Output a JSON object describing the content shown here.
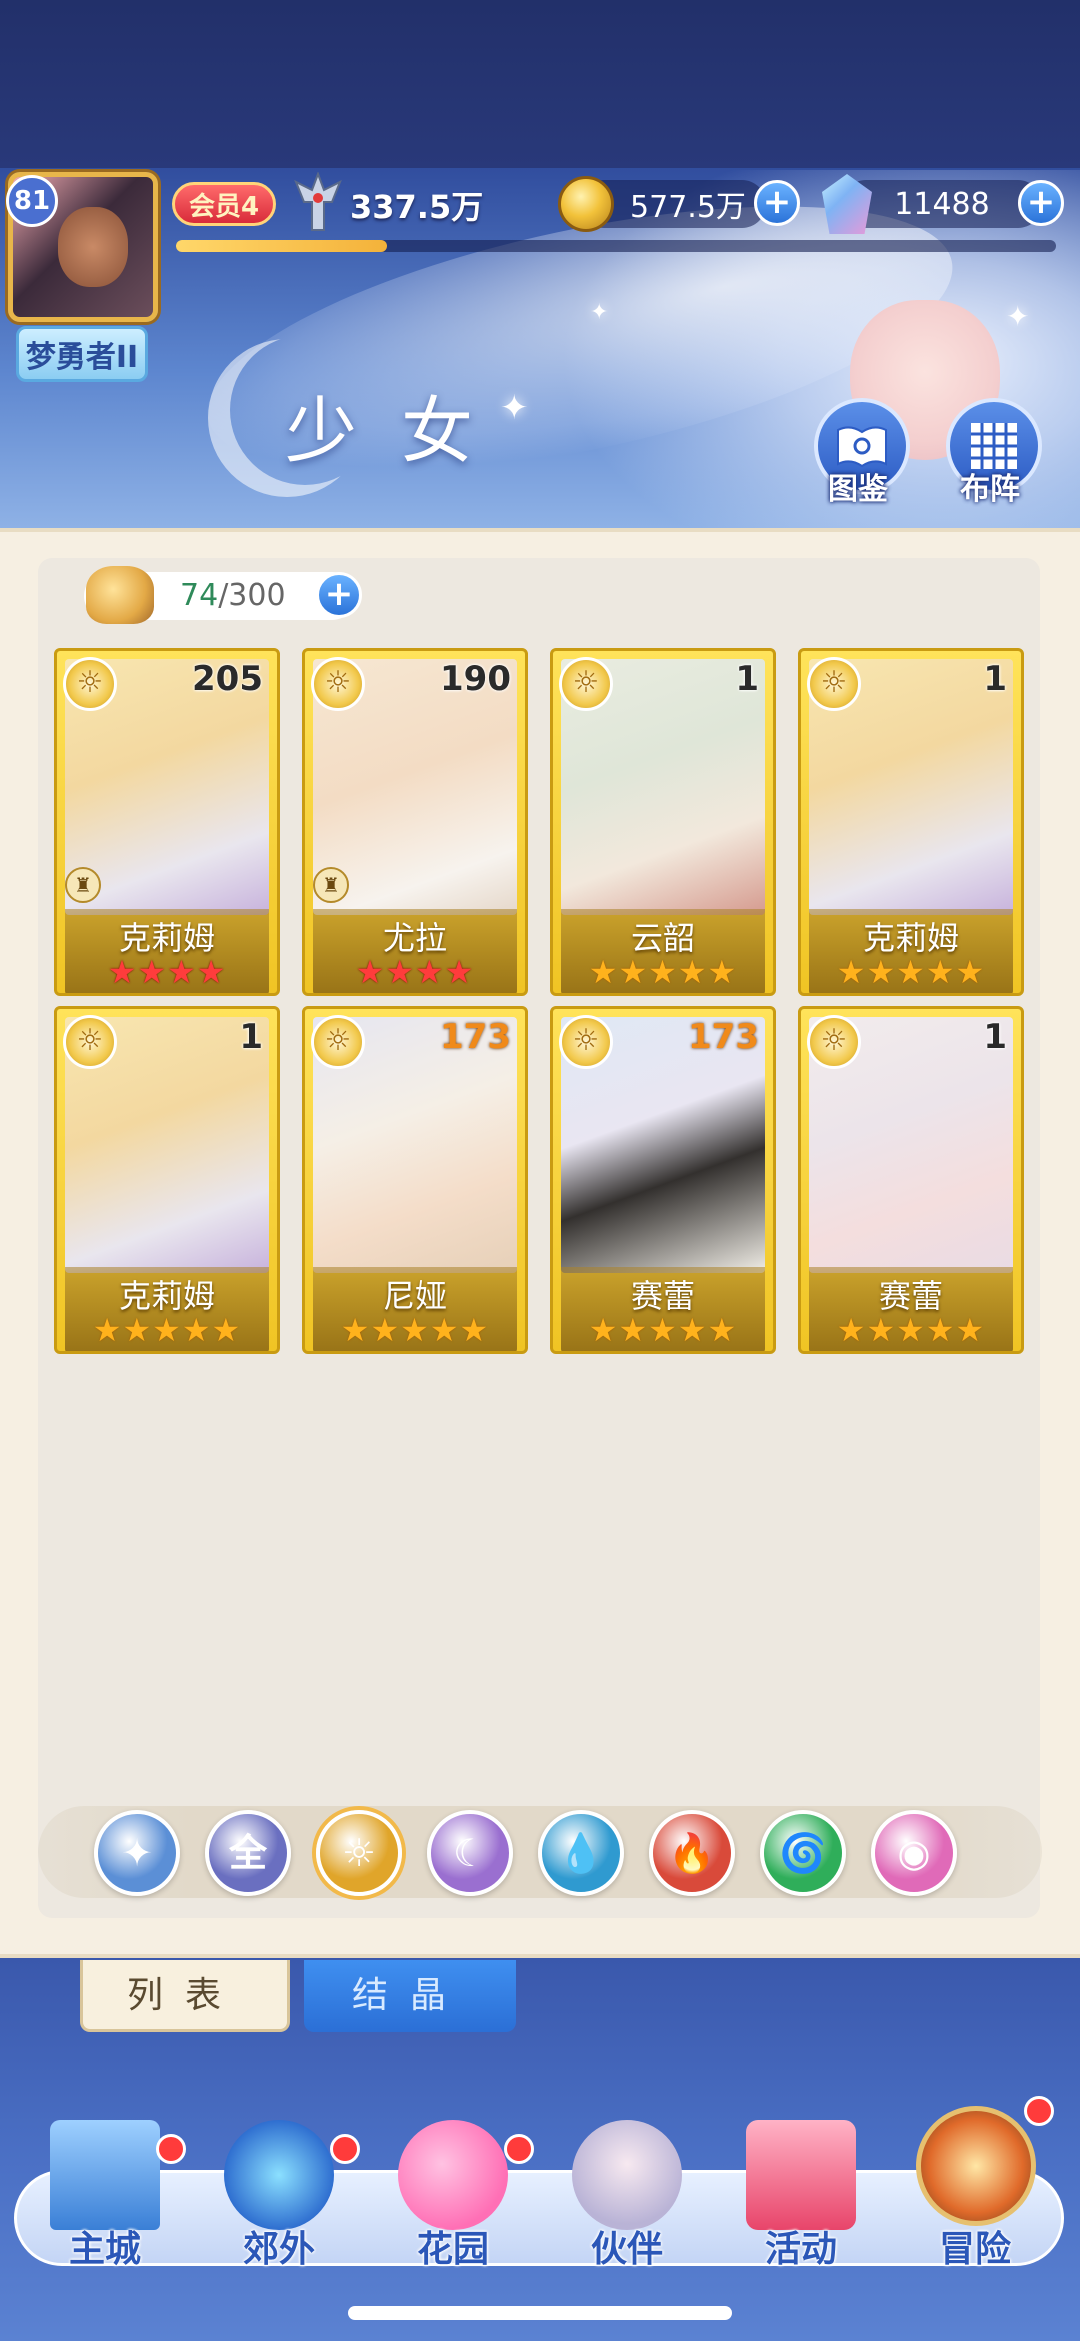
{
  "header": {
    "player_level": "81",
    "title_badge": "梦勇者II",
    "vip_label": "会员4",
    "power": "337.5万",
    "gold": "577.5万",
    "crystals": "11488",
    "exp_progress": 0.24
  },
  "page": {
    "title": "少女",
    "illustrated_label": "图鉴",
    "formation_label": "布阵"
  },
  "roster": {
    "count_current": "74",
    "count_sep_max": "/300"
  },
  "cards": [
    {
      "name": "克莉姆",
      "level": "205",
      "stars": "★★★★",
      "star_color": "red",
      "level_color": "dark",
      "role": "♜"
    },
    {
      "name": "尤拉",
      "level": "190",
      "stars": "★★★★",
      "star_color": "red",
      "level_color": "dark",
      "role": "♜"
    },
    {
      "name": "云韶",
      "level": "1",
      "stars": "★★★★★",
      "star_color": "gold",
      "level_color": "dark",
      "role": ""
    },
    {
      "name": "克莉姆",
      "level": "1",
      "stars": "★★★★★",
      "star_color": "gold",
      "level_color": "dark",
      "role": ""
    },
    {
      "name": "克莉姆",
      "level": "1",
      "stars": "★★★★★",
      "star_color": "gold",
      "level_color": "dark",
      "role": ""
    },
    {
      "name": "尼娅",
      "level": "173",
      "stars": "★★★★★",
      "star_color": "gold",
      "level_color": "orange",
      "role": ""
    },
    {
      "name": "赛蕾",
      "level": "173",
      "stars": "★★★★★",
      "star_color": "gold",
      "level_color": "orange",
      "role": ""
    },
    {
      "name": "赛蕾",
      "level": "1",
      "stars": "★★★★★",
      "star_color": "gold",
      "level_color": "dark",
      "role": ""
    }
  ],
  "filters": [
    {
      "id": "star",
      "label": "✦",
      "color": "#5b8fd6"
    },
    {
      "id": "all",
      "label": "全",
      "color": "#6a6fc0"
    },
    {
      "id": "light",
      "label": "☼",
      "color": "#e0a52a"
    },
    {
      "id": "moon",
      "label": "☾",
      "color": "#9a6fd0"
    },
    {
      "id": "water",
      "label": "💧",
      "color": "#2f9ad0"
    },
    {
      "id": "fire",
      "label": "🔥",
      "color": "#d94a3a"
    },
    {
      "id": "wind",
      "label": "🌀",
      "color": "#2fae5a"
    },
    {
      "id": "orbit",
      "label": "◉",
      "color": "#e06ab8"
    }
  ],
  "tabs": {
    "list": "列表",
    "crystal": "结晶"
  },
  "nav": [
    {
      "label": "主城",
      "icon": "castle-icon",
      "badge": true
    },
    {
      "label": "郊外",
      "icon": "portal-icon",
      "badge": true
    },
    {
      "label": "花园",
      "icon": "heart-icon",
      "badge": true
    },
    {
      "label": "伙伴",
      "icon": "partner-icon",
      "badge": false
    },
    {
      "label": "活动",
      "icon": "gift-icon",
      "badge": false
    },
    {
      "label": "冒险",
      "icon": "compass-icon",
      "badge": true
    }
  ],
  "colors": {
    "accent_blue": "#2b73d9",
    "card_gold": "#f0c424",
    "panel_bg": "#f6efe2"
  }
}
